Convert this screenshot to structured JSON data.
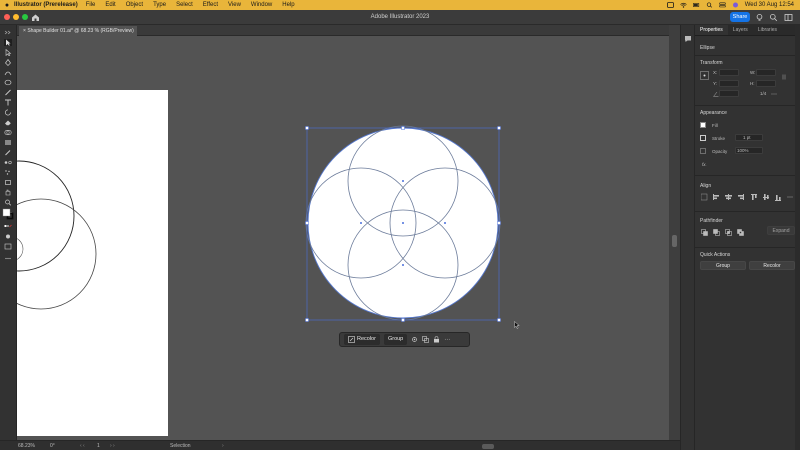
{
  "menubar": {
    "app_name": "Illustrator (Prerelease)",
    "items": [
      "File",
      "Edit",
      "Object",
      "Type",
      "Select",
      "Effect",
      "View",
      "Window",
      "Help"
    ],
    "clock": "Wed 30 Aug  12:54"
  },
  "window": {
    "title": "Adobe Illustrator 2023",
    "share_label": "Share"
  },
  "document": {
    "tab_label": "Shape Builder 01.ai* @ 68.23 % (RGB/Preview)"
  },
  "context_bar": {
    "recolor_label": "Recolor",
    "group_label": "Group",
    "more_label": "···"
  },
  "panel": {
    "tabs": [
      "Properties",
      "Layers",
      "Libraries"
    ],
    "object_type": "Ellipse",
    "transform_title": "Transform",
    "x_label": "X:",
    "y_label": "Y:",
    "w_label": "W:",
    "h_label": "H:",
    "angle_value": "1/4",
    "appearance_title": "Appearance",
    "fill_label": "Fill",
    "stroke_label": "Stroke",
    "stroke_value": "1 pt",
    "opacity_label": "Opacity",
    "opacity_value": "100%",
    "fx_label": "fx.",
    "align_title": "Align",
    "pathfinder_title": "Pathfinder",
    "expand_label": "Expand",
    "quick_actions_title": "Quick Actions",
    "group_button": "Group",
    "recolor_button": "Recolor"
  },
  "statusbar": {
    "zoom": "68.23%",
    "rotation": "0°",
    "artboard_num": "1",
    "tool": "Selection"
  },
  "colors": {
    "menubar_bg": "#e9b53a",
    "share_blue": "#1473e6",
    "selection_blue": "#4a6fdc"
  }
}
